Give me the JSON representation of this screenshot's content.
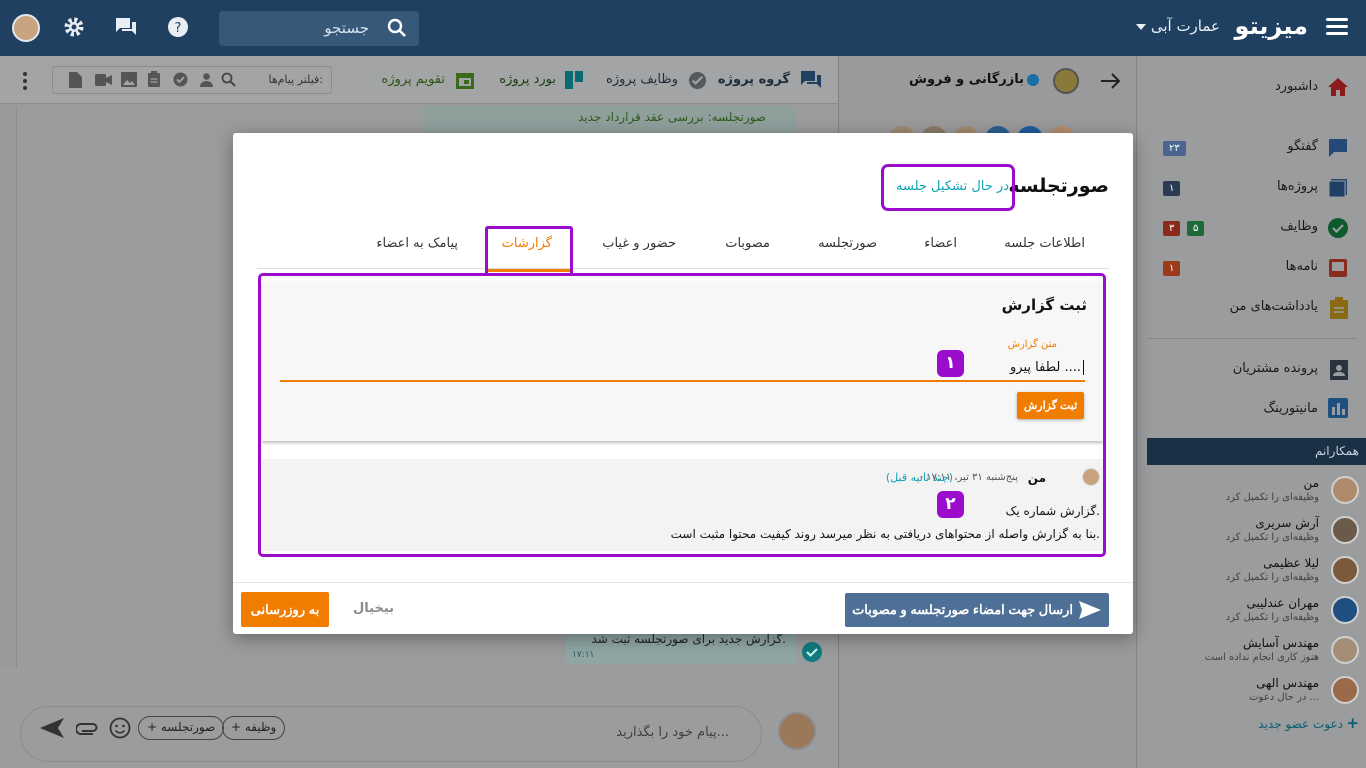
{
  "topbar": {
    "app_name": "میزیتو",
    "organization": "عمارت آبی",
    "search_placeholder": "جستجو"
  },
  "chat": {
    "tabs": [
      "گروه پروژه",
      "وظایف پروژه",
      "بورد پروژه",
      "تقویم پروژه"
    ],
    "filter_placeholder": "فیلتر پیام‌ها:",
    "composer_placeholder": "پیام خود را بگذارید...",
    "chips": [
      "+ صورتجلسه",
      "+ وظیفه"
    ],
    "bg_message": "گزارش جدید برای صورتجلسه ثبت شد.",
    "bg_message_time": "۱۷:۱۱",
    "bg_top_message": "صورتجلسه: بررسی عقد قرارداد جدید"
  },
  "project": {
    "name": "بازرگانی و فروش"
  },
  "sidebar": {
    "items": [
      {
        "label": "داشبورد"
      },
      {
        "label": "گفتگو",
        "badge": "۲۳"
      },
      {
        "label": "پروژه‌ها",
        "badge": "۱"
      },
      {
        "label": "وظایف",
        "badge": "۵",
        "badge2": "۳"
      },
      {
        "label": "نامه‌ها",
        "badge": "۱"
      },
      {
        "label": "یادداشت‌های من"
      },
      {
        "label": "پرونده مشتریان"
      },
      {
        "label": "مانیتورینگ"
      }
    ],
    "colleagues_header": "همکارانم",
    "colleagues": [
      {
        "name": "من",
        "status": "وظیفه‌ای را تکمیل کرد"
      },
      {
        "name": "آرش سریری",
        "status": "وظیفه‌ای را تکمیل کرد"
      },
      {
        "name": "لیلا عظیمی",
        "status": "وظیفه‌ای را تکمیل کرد"
      },
      {
        "name": "مهران عندلیبی",
        "status": "وظیفه‌ای را تکمیل کرد"
      },
      {
        "name": "مهندس آسایش",
        "status": "هنوز کاری انجام نداده است"
      },
      {
        "name": "مهندس الهی",
        "status": "در حال دعوت ..."
      }
    ],
    "invite": "دعوت عضو جدید"
  },
  "modal": {
    "title": "صورتجلسه",
    "status": "در حال تشکیل جلسه",
    "tabs": [
      "اطلاعات جلسه",
      "اعضاء",
      "صورتجلسه",
      "مصوبات",
      "حضور و غیاب",
      "گزارشات",
      "پیامک به اعضاء"
    ],
    "form_title": "ثبت گزارش",
    "field_label": "متن گزارش",
    "field_value": "لطفا پیرو ....",
    "submit_label": "ثبت گزارش",
    "marker1": "۱",
    "marker2": "۲",
    "report": {
      "author": "من",
      "meta": "- پنج‌شنبه ۳۱ تیر، ۱۷:۱۱",
      "ago": "(چند ثانیه قبل)",
      "title": "گزارش شماره یک.",
      "body": "بنا به گزارش واصله از محتواهای دریافتی به نظر میرسد روند کیفیت محتوا مثبت است."
    },
    "send_label": "ارسال جهت امضاء صورتجلسه و مصوبات",
    "cancel_label": "بیخیال",
    "update_label": "به روزرسانی"
  },
  "colors": {
    "accent": "#f07c00",
    "highlight": "#9b0ccc",
    "primary": "#1f4061",
    "teal": "#0fa3b5"
  }
}
